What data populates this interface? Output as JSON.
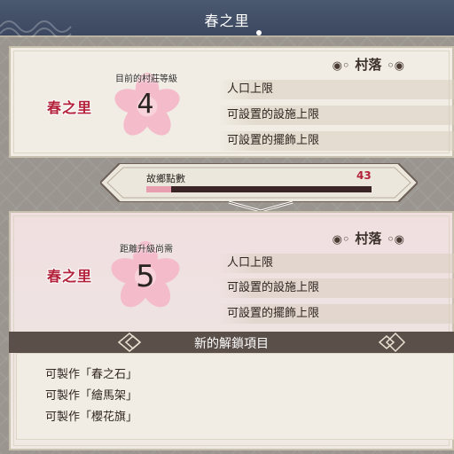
{
  "header": {
    "title": "春之里"
  },
  "current": {
    "village_name": "春之里",
    "level_label": "目前的村莊等級",
    "level": "4",
    "section_title": "村落",
    "stats": [
      "人口上限",
      "可設置的設施上限",
      "可設置的擺飾上限"
    ]
  },
  "points": {
    "label": "故鄉點數",
    "value": "43",
    "progress_fraction": 0.11
  },
  "next": {
    "village_name": "春之里",
    "level_label": "距離升級尚需",
    "level": "5",
    "section_title": "村落",
    "stats": [
      "人口上限",
      "可設置的設施上限",
      "可設置的擺飾上限"
    ]
  },
  "unlocks": {
    "title": "新的解鎖項目",
    "items": [
      "可製作「春之石」",
      "可製作「繪馬架」",
      "可製作「櫻花旗」"
    ]
  },
  "colors": {
    "title_bar": "#3b4860",
    "accent_red": "#b3213a",
    "blossom": "#f2b8c6",
    "progress_fill": "#e8a0b0",
    "progress_track": "#3b2426",
    "unlock_bar": "#5b4f4a"
  },
  "icons": {
    "section_ornament": "cloud-swirl-icon",
    "level_badge": "cherry-blossom-icon",
    "expand": "chevron-down-icon",
    "corner": "diamond-ornament-icon"
  }
}
